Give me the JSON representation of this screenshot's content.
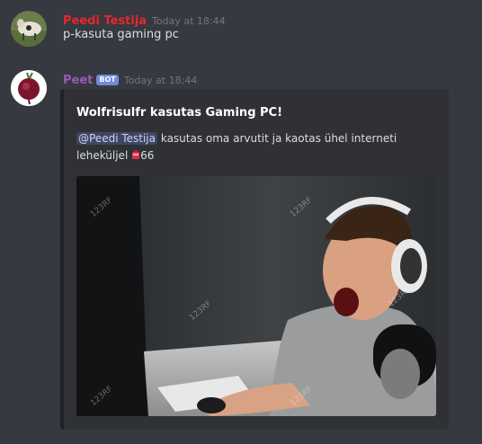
{
  "messages": [
    {
      "username": "Peedi Testija",
      "username_color": "#e3282d",
      "timestamp": "Today at 18:44",
      "text": "p-kasuta gaming pc"
    },
    {
      "username": "Peet",
      "username_color": "#9b59b6",
      "bot_tag": "BOT",
      "timestamp": "Today at 18:44",
      "embed": {
        "title": "Wolfrisulfr kasutas Gaming PC!",
        "mention": "@Peedi Testija",
        "description": "kasutas oma arvutit ja kaotas ühel interneti leheküljel",
        "amount": "66",
        "image_watermark": "123RF"
      }
    }
  ]
}
